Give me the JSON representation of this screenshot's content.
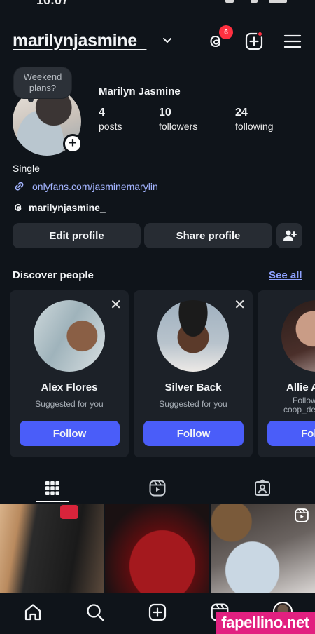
{
  "status_bar": {
    "time": "10:07"
  },
  "header": {
    "username": "marilynjasmine_",
    "threads_badge": "6"
  },
  "profile": {
    "note": "Weekend plans?",
    "full_name": "Marilyn Jasmine",
    "stats": [
      {
        "value": "4",
        "label": "posts"
      },
      {
        "value": "10",
        "label": "followers"
      },
      {
        "value": "24",
        "label": "following"
      }
    ],
    "bio": "Single",
    "link": "onlyfans.com/jasminemarylin",
    "threads_handle": "marilynjasmine_"
  },
  "actions": {
    "edit": "Edit profile",
    "share": "Share profile"
  },
  "discover": {
    "title": "Discover people",
    "see_all": "See all",
    "cards": [
      {
        "name": "Alex Flores",
        "subtitle": "Suggested for you",
        "button": "Follow"
      },
      {
        "name": "Silver Back",
        "subtitle": "Suggested for you",
        "button": "Follow"
      },
      {
        "name": "Allie A",
        "subtitle": "Follow",
        "subtitle2": "coop_de",
        "button": "Fol"
      }
    ]
  },
  "watermark": "fapellino.net",
  "colors": {
    "background": "#0f141a",
    "button": "#272c33",
    "accent": "#4a5df9",
    "link": "#a3b4ff",
    "badge": "#ff3040"
  }
}
